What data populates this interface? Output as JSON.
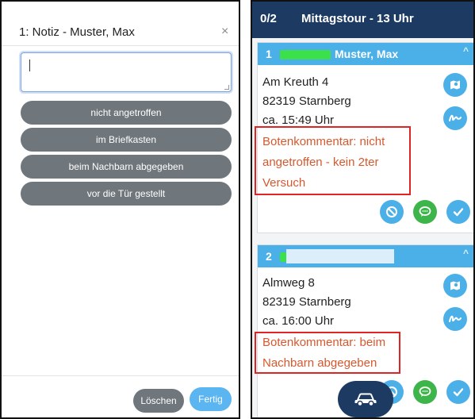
{
  "note_dialog": {
    "title": "1: Notiz - Muster, Max",
    "close_symbol": "×",
    "note_input_value": "",
    "quick_notes": [
      "nicht angetroffen",
      "im Briefkasten",
      "beim Nachbarn abgegeben",
      "vor die Tür gestellt"
    ],
    "delete_label": "Löschen",
    "done_label": "Fertig"
  },
  "tour": {
    "count": "0/2",
    "title": "Mittagstour - 13 Uhr",
    "stops": [
      {
        "number": "1",
        "name": "Muster, Max",
        "street": "Am Kreuth 4",
        "city": "82319 Starnberg",
        "time": "ca. 15:49 Uhr",
        "comment_lines": [
          "Botenkommentar: nicht",
          "angetroffen - kein 2ter",
          "Versuch"
        ]
      },
      {
        "number": "2",
        "name": "",
        "street": "Almweg 8",
        "city": "82319 Starnberg",
        "time": "ca. 16:00 Uhr",
        "comment_lines": [
          "Botenkommentar: beim",
          "Nachbarn abgegeben"
        ]
      }
    ]
  },
  "icons": {
    "close": "close-icon",
    "collapse": "chevron-up-icon",
    "map": "map-pin-icon",
    "signature": "signature-icon",
    "not_delivered": "cancel-circle-icon",
    "message": "chat-bubble-icon",
    "confirm": "checkmark-icon",
    "navigate": "car-icon"
  },
  "colors": {
    "header_navy": "#1d3a63",
    "card_header_blue": "#4cb0e8",
    "pill_gray": "#6f767c",
    "done_blue": "#5ab5f0",
    "message_green": "#3db54a",
    "comment_orange": "#d8582e",
    "highlight_red": "#e02424",
    "redaction_green": "#3be04a"
  }
}
